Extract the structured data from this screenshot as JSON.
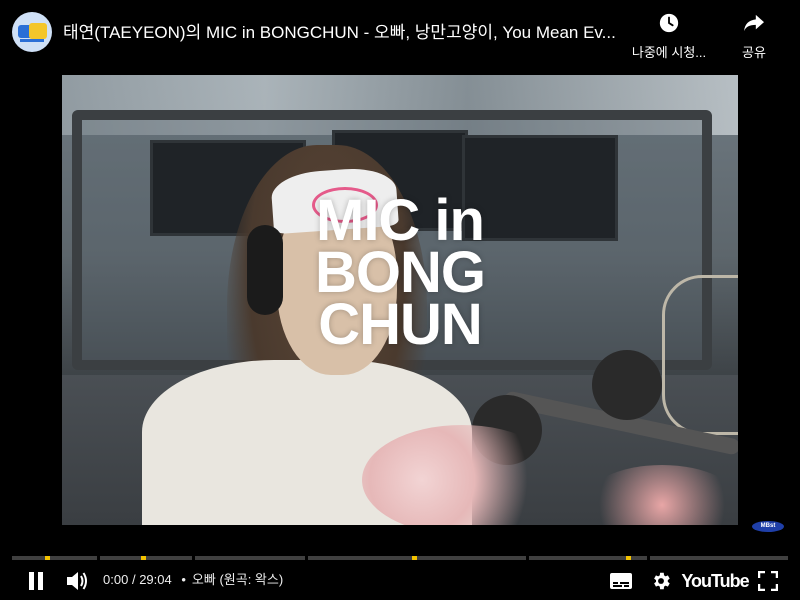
{
  "header": {
    "title": "태연(TAEYEON)의 MIC in BONGCHUN - 오빠, 낭만고양이, You Mean Ev...",
    "watch_later_label": "나중에 시청...",
    "share_label": "공유"
  },
  "video": {
    "overlay_logo_lines": [
      "MIC in",
      "BONG",
      "CHUN"
    ],
    "watermark": "MBst"
  },
  "controls": {
    "current_time": "0:00",
    "separator": "/",
    "duration": "29:04",
    "bullet": "•",
    "chapter": "오빠 (원곡: 왁스)",
    "youtube_label": "YouTube"
  },
  "colors": {
    "chapter_marker": "#f4c300",
    "watermark_bg": "#1f3fa8"
  },
  "icons": {
    "watch_later": "clock-icon",
    "share": "share-arrow-icon",
    "pause": "pause-icon",
    "volume": "volume-icon",
    "captions": "captions-icon",
    "settings": "gear-icon",
    "fullscreen": "fullscreen-icon"
  }
}
